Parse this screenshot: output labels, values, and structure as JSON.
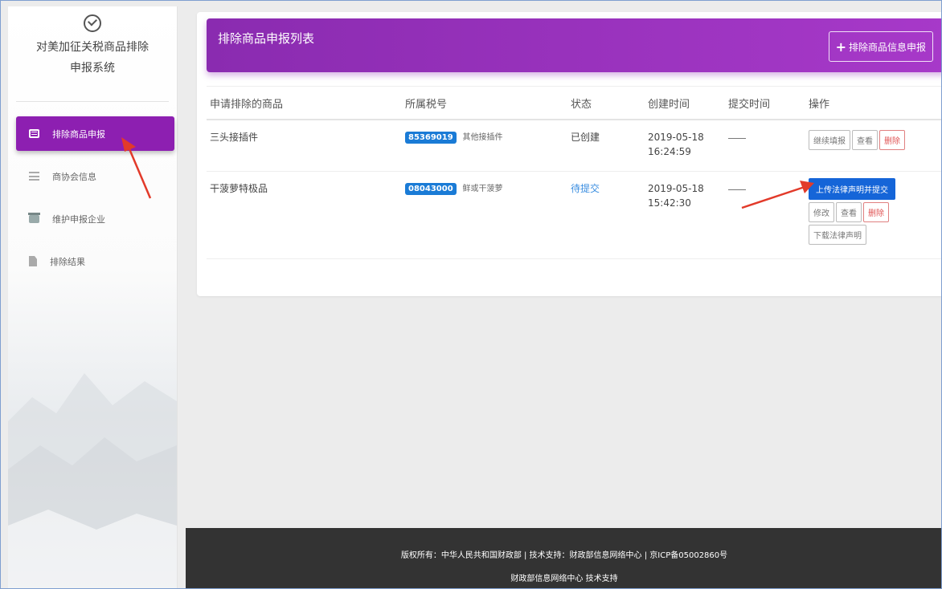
{
  "sidebar": {
    "title_line1": "对美加征关税商品排除",
    "title_line2": "申报系统",
    "items": [
      {
        "label": "排除商品申报",
        "icon": "list-icon",
        "active": true
      },
      {
        "label": "商协会信息",
        "icon": "sliders-icon"
      },
      {
        "label": "维护申报企业",
        "icon": "store-icon"
      },
      {
        "label": "排除结果",
        "icon": "document-icon"
      }
    ]
  },
  "header": {
    "title": "排除商品申报列表",
    "add_button": "排除商品信息申报"
  },
  "table": {
    "columns": [
      "申请排除的商品",
      "所属税号",
      "状态",
      "创建时间",
      "提交时间",
      "操作"
    ],
    "rows": [
      {
        "product": "三头接插件",
        "tax_code": "85369019",
        "tax_name": "其他接插件",
        "status": "已创建",
        "created_date": "2019-05-18",
        "created_time": "16:24:59",
        "submitted": "—",
        "actions": [
          "继续填报",
          "查看",
          "删除"
        ]
      },
      {
        "product": "干菠萝特极品",
        "tax_code": "08043000",
        "tax_name": "鲜或干菠萝",
        "status": "待提交",
        "created_date": "2019-05-18",
        "created_time": "15:42:30",
        "submitted": "—",
        "actions": [
          "上传法律声明并提交",
          "修改",
          "查看",
          "删除",
          "下载法律声明"
        ]
      }
    ]
  },
  "footer": {
    "line1": "版权所有：中华人民共和国财政部 | 技术支持：财政部信息网络中心 | 京ICP备05002860号",
    "line2": "财政部信息网络中心 技术支持"
  },
  "colors": {
    "accent": "#8d1fb1",
    "primary_button": "#1565d8",
    "annotation_arrow": "#e23a2a"
  }
}
